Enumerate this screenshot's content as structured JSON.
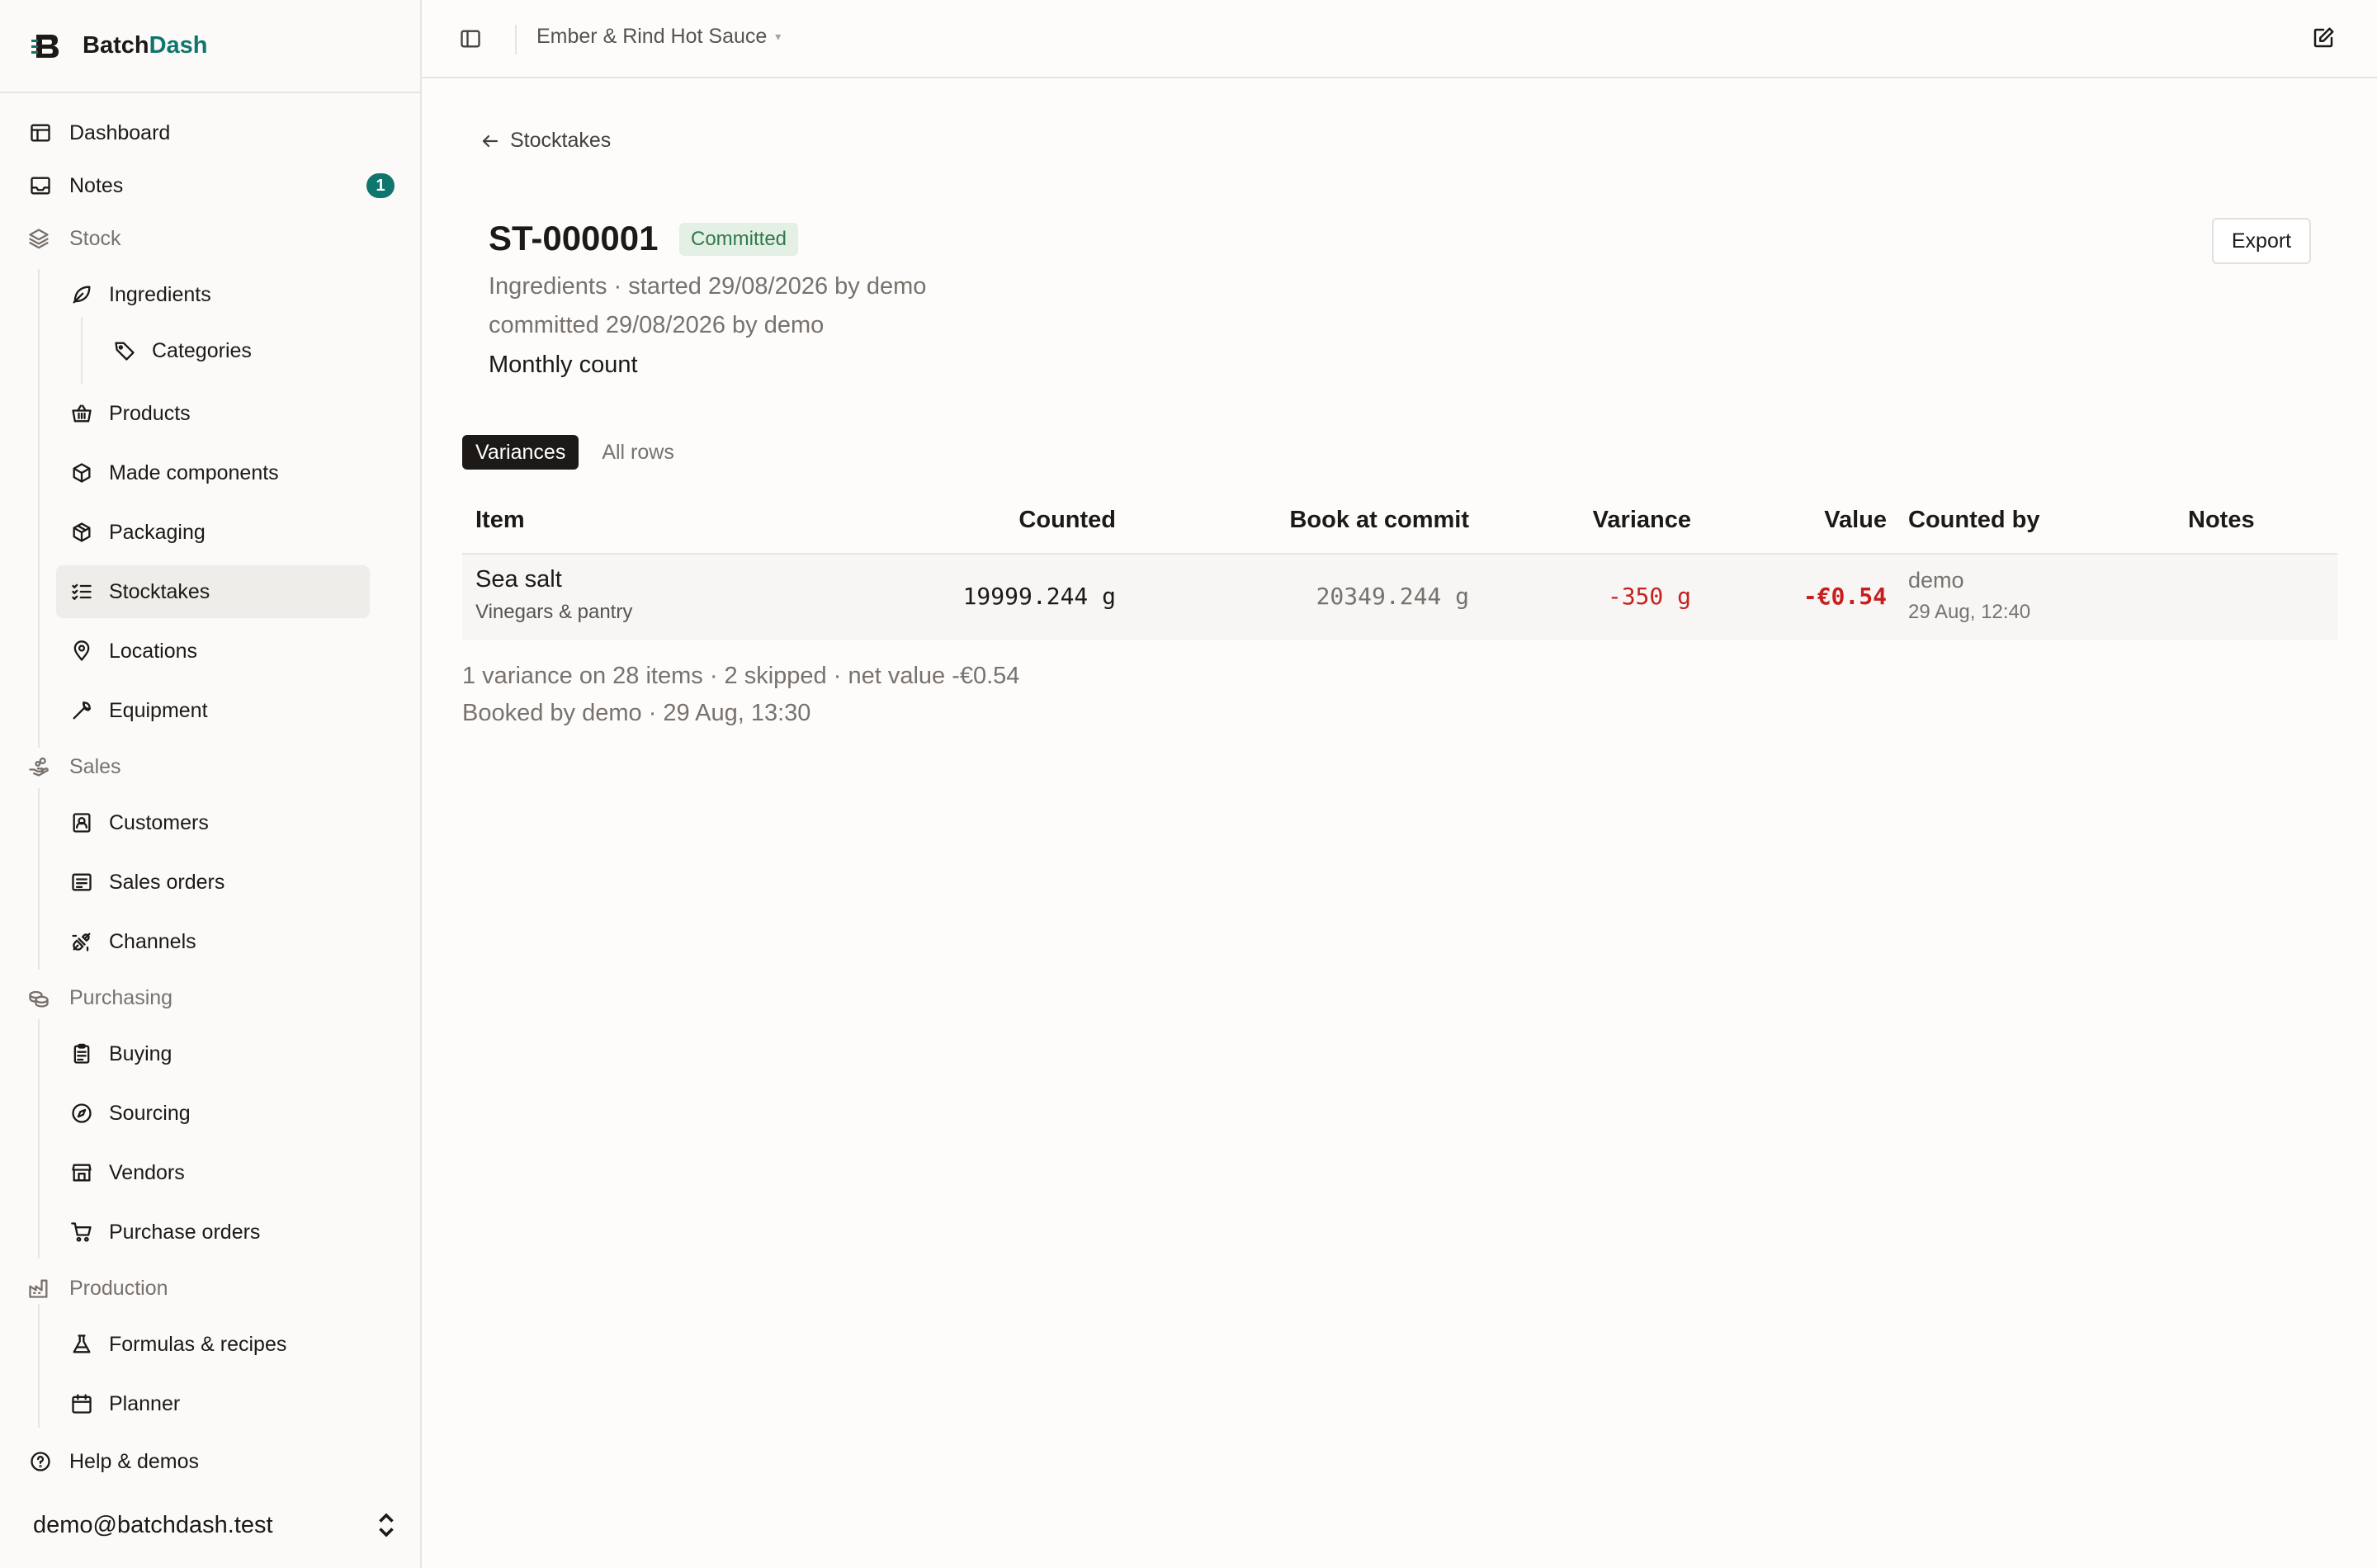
{
  "brand": {
    "name_prefix": "Batch",
    "name_accent": "Dash"
  },
  "sidebar": {
    "dashboard": "Dashboard",
    "notes": "Notes",
    "notes_badge": "1",
    "stock": "Stock",
    "ingredients": "Ingredients",
    "categories": "Categories",
    "products": "Products",
    "made_components": "Made components",
    "packaging": "Packaging",
    "stocktakes": "Stocktakes",
    "locations": "Locations",
    "equipment": "Equipment",
    "sales": "Sales",
    "customers": "Customers",
    "sales_orders": "Sales orders",
    "channels": "Channels",
    "purchasing": "Purchasing",
    "buying": "Buying",
    "sourcing": "Sourcing",
    "vendors": "Vendors",
    "purchase_orders": "Purchase orders",
    "production": "Production",
    "formulas": "Formulas & recipes",
    "planner": "Planner",
    "help": "Help & demos",
    "user_email": "demo@batchdash.test"
  },
  "topbar": {
    "workspace": "Ember & Rind Hot Sauce",
    "caret": "▾"
  },
  "page": {
    "back_label": "Stocktakes",
    "title": "ST-000001",
    "status": "Committed",
    "meta_started": "Ingredients · started 29/08/2026 by demo",
    "meta_committed": "committed 29/08/2026 by demo",
    "description": "Monthly count",
    "export_label": "Export"
  },
  "tabs": {
    "variances": "Variances",
    "all_rows": "All rows"
  },
  "table": {
    "headers": {
      "item": "Item",
      "counted": "Counted",
      "book": "Book at commit",
      "variance": "Variance",
      "value": "Value",
      "counted_by": "Counted by",
      "notes": "Notes"
    },
    "rows": [
      {
        "item": "Sea salt",
        "category": "Vinegars & pantry",
        "counted": "19999.244 g",
        "book": "20349.244 g",
        "variance": "-350 g",
        "value": "-€0.54",
        "counted_by": "demo",
        "counted_at": "29 Aug, 12:40",
        "notes": ""
      }
    ]
  },
  "summary": {
    "line1": "1 variance on 28 items · 2 skipped · net value -€0.54",
    "line2": "Booked by demo · 29 Aug, 13:30"
  },
  "colors": {
    "accent": "#0f766e",
    "negative": "#c81e1e",
    "status_bg": "#e4efe6",
    "status_fg": "#2f7a46"
  }
}
